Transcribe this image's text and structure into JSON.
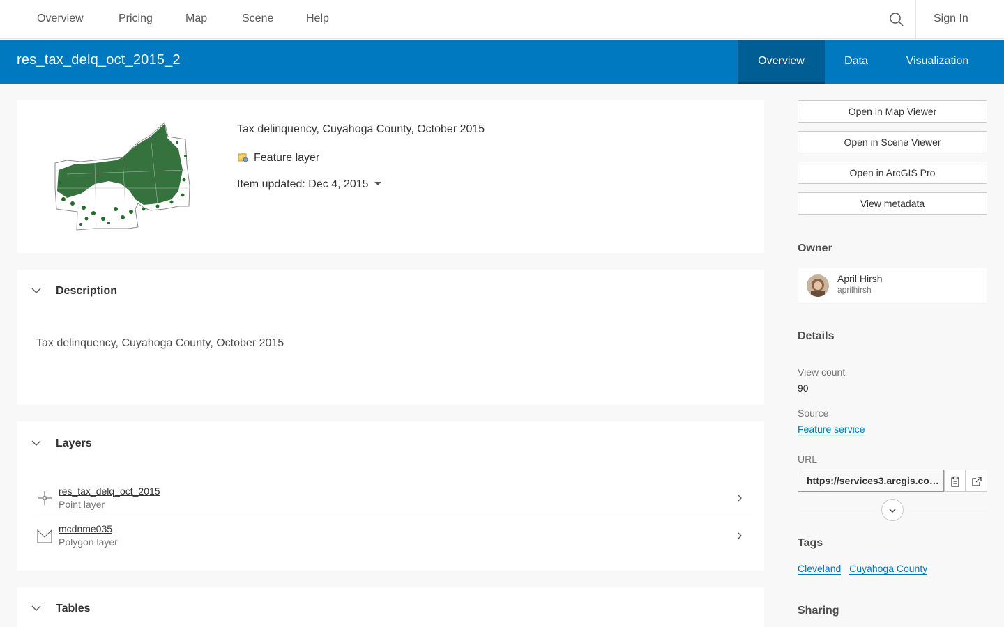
{
  "topnav": {
    "items": [
      {
        "label": "Overview"
      },
      {
        "label": "Pricing"
      },
      {
        "label": "Map"
      },
      {
        "label": "Scene"
      },
      {
        "label": "Help"
      }
    ],
    "search_icon": "search-icon",
    "sign_in": "Sign In"
  },
  "header": {
    "title": "res_tax_delq_oct_2015_2",
    "tabs": [
      {
        "label": "Overview",
        "active": true
      },
      {
        "label": "Data",
        "active": false
      },
      {
        "label": "Visualization",
        "active": false
      }
    ],
    "color": "#0079c1"
  },
  "summary": {
    "snippet": "Tax delinquency, Cuyahoga County, October 2015",
    "item_type": "Feature layer",
    "updated": "Item updated: Dec 4, 2015"
  },
  "description": {
    "heading": "Description",
    "text": "Tax delinquency, Cuyahoga County, October 2015"
  },
  "layers": {
    "heading": "Layers",
    "items": [
      {
        "name": "res_tax_delq_oct_2015",
        "type": "Point layer",
        "icon": "point-layer-icon"
      },
      {
        "name": "mcdnme035",
        "type": "Polygon layer",
        "icon": "polygon-layer-icon"
      }
    ]
  },
  "tables": {
    "heading": "Tables"
  },
  "sidebar": {
    "buttons": [
      {
        "label": "Open in Map Viewer"
      },
      {
        "label": "Open in Scene Viewer"
      },
      {
        "label": "Open in ArcGIS Pro"
      },
      {
        "label": "View metadata"
      }
    ],
    "owner_heading": "Owner",
    "owner": {
      "name": "April Hirsh",
      "username": "aprilhirsh"
    },
    "details_heading": "Details",
    "details": {
      "view_count_label": "View count",
      "view_count": "90",
      "source_label": "Source",
      "source": "Feature service",
      "url_label": "URL",
      "url": "https://services3.arcgis.co…"
    },
    "tags_heading": "Tags",
    "tags": [
      "Cleveland",
      "Cuyahoga County"
    ],
    "sharing_heading": "Sharing"
  }
}
